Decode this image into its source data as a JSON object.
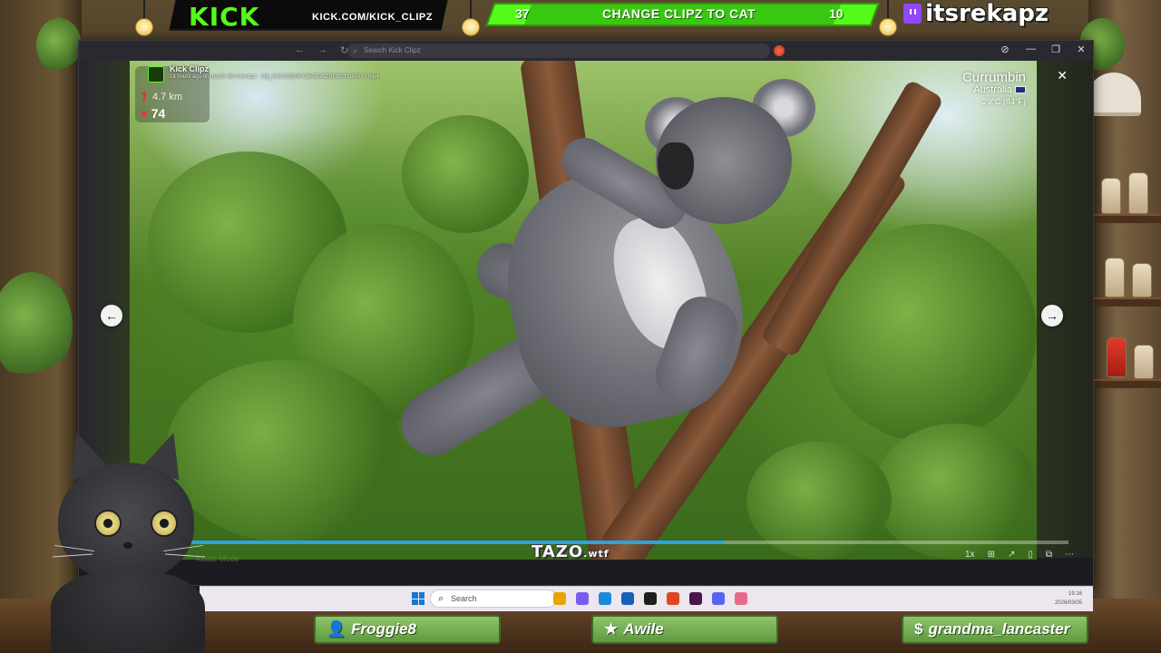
{
  "overlay": {
    "kick_logo": "KICK",
    "kick_url": "KICK.COM/KICK_CLIPZ",
    "vote": {
      "left_count": "37",
      "title": "CHANGE CLIPZ TO CAT",
      "right_count": "10"
    },
    "handle": "itsrekapz",
    "icons": {
      "handle_icon": "twitch-icon"
    }
  },
  "browser": {
    "search_placeholder": "Search Kick Clipz",
    "nav": [
      "←",
      "→",
      "↻"
    ],
    "window_controls": [
      "⊘",
      "—",
      "❐",
      "✕"
    ]
  },
  "clip": {
    "channel": "Kick Clipz",
    "meta": "18 hours ago on march 4th kickclipz · clip_01KJVQ9WY38A9GNZRE9GYGASFM.mp4",
    "distance": "4.7 km",
    "likes": "74",
    "location": {
      "city": "Currumbin",
      "country": "Australia",
      "temperature": "29°C (84°F)"
    },
    "close_label": "✕",
    "prev_label": "←",
    "next_label": "→",
    "progress": 0.64,
    "progress_color": "#2ca3e0",
    "watermark": "Koala Mode",
    "brand_logo": "TAZO",
    "brand_suffix": ".wtf",
    "player_controls": [
      "1x",
      "⊞",
      "↗",
      "▯",
      "⧉",
      "⋯"
    ]
  },
  "taskbar": {
    "search_label": "Search",
    "time": "19:16",
    "date": "2026/03/05",
    "apps": [
      {
        "name": "file-explorer-icon",
        "color": "#e8a400"
      },
      {
        "name": "copilot-icon",
        "color": "#7b5cf0"
      },
      {
        "name": "edge-icon",
        "color": "#1c8adb"
      },
      {
        "name": "store-icon",
        "color": "#1460b8"
      },
      {
        "name": "obs-icon",
        "color": "#1e1e1e"
      },
      {
        "name": "brave-icon",
        "color": "#e0471e"
      },
      {
        "name": "slack-icon",
        "color": "#4a154b"
      },
      {
        "name": "discord-icon",
        "color": "#5865f2"
      },
      {
        "name": "heart-app-icon",
        "color": "#e86a8a"
      }
    ]
  },
  "viewers": [
    {
      "name": "Froggie8",
      "icon": "user-icon"
    },
    {
      "name": "Awile",
      "icon": "star-icon"
    },
    {
      "name": "grandma_lancaster",
      "icon": "dollar-icon"
    }
  ],
  "colors": {
    "kick_green": "#53fc18",
    "vote_green": "#38c810",
    "tag_green": "#8ec36a"
  }
}
